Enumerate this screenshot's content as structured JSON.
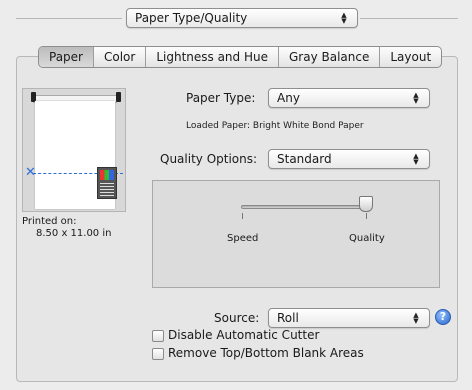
{
  "top_popup": {
    "value": "Paper Type/Quality"
  },
  "tabs": [
    {
      "label": "Paper",
      "active": true
    },
    {
      "label": "Color",
      "active": false
    },
    {
      "label": "Lightness and Hue",
      "active": false
    },
    {
      "label": "Gray Balance",
      "active": false
    },
    {
      "label": "Layout",
      "active": false
    }
  ],
  "preview": {
    "printed_on_label": "Printed on:",
    "paper_size": "8.50 x 11.00 in"
  },
  "paper_type": {
    "label": "Paper Type:",
    "value": "Any"
  },
  "loaded_paper": "Loaded Paper: Bright White Bond Paper",
  "quality_options": {
    "label": "Quality Options:",
    "value": "Standard"
  },
  "slider": {
    "left_label": "Speed",
    "right_label": "Quality",
    "level": 1.0
  },
  "source": {
    "label": "Source:",
    "value": "Roll"
  },
  "checkboxes": [
    {
      "label": "Disable Automatic Cutter",
      "checked": false
    },
    {
      "label": "Remove Top/Bottom Blank Areas",
      "checked": false
    }
  ],
  "icons": {
    "help": "help-icon",
    "popup_arrows": "updown-arrows-icon",
    "cut_marker": "cut-x-icon",
    "printer": "printer-icon"
  }
}
